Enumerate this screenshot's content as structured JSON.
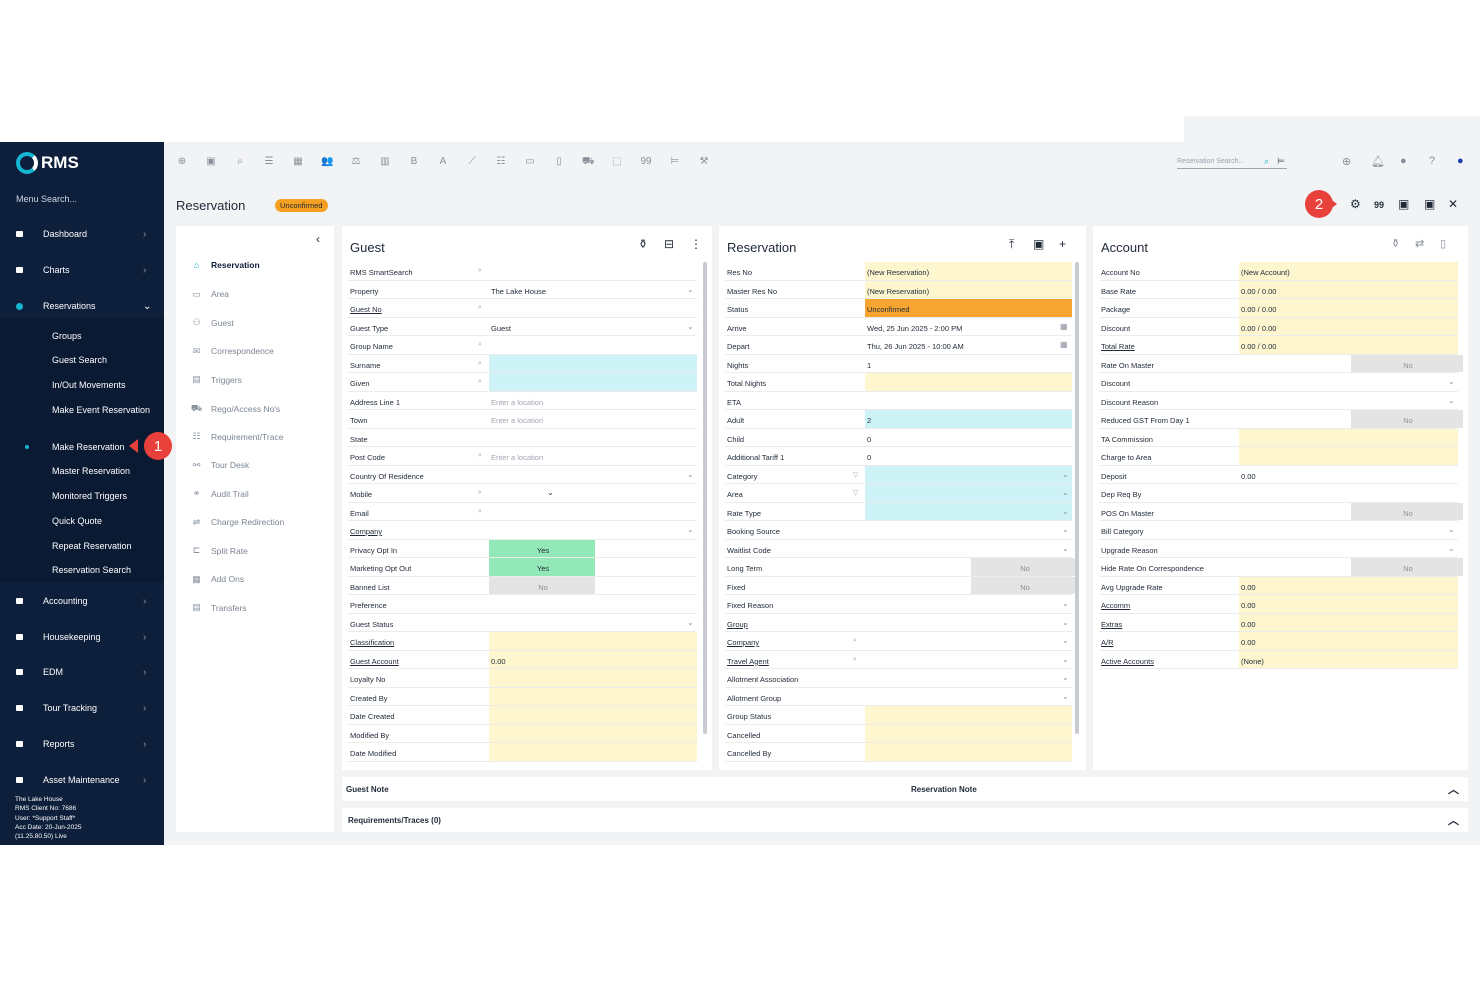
{
  "app": {
    "logo": "RMS"
  },
  "sidebar": {
    "search_placeholder": "Menu Search...",
    "items": [
      {
        "label": "Dashboard",
        "icon": "dashboard-icon"
      },
      {
        "label": "Charts",
        "icon": "charts-icon"
      },
      {
        "label": "Reservations",
        "icon": "reservations-icon"
      },
      {
        "label": "Accounting",
        "icon": "accounting-icon"
      },
      {
        "label": "Housekeeping",
        "icon": "housekeeping-icon"
      },
      {
        "label": "EDM",
        "icon": "edm-icon"
      },
      {
        "label": "Tour Tracking",
        "icon": "tour-tracking-icon"
      },
      {
        "label": "Reports",
        "icon": "reports-icon"
      },
      {
        "label": "Asset Maintenance",
        "icon": "asset-maintenance-icon"
      }
    ],
    "sub_items": [
      "Groups",
      "Guest Search",
      "In/Out Movements",
      "Make Event Reservation",
      "Make Reservation",
      "Master Reservation",
      "Monitored Triggers",
      "Quick Quote",
      "Repeat Reservation",
      "Reservation Search"
    ],
    "footer": [
      "The Lake House",
      "RMS Client No: 7686",
      "User: *Support Staff*",
      "Acc Date: 20-Jun-2025",
      "(11.25.80.50) Live"
    ]
  },
  "callouts": [
    "1",
    "2"
  ],
  "toolbar": {
    "icons": [
      "add-icon",
      "calendar-icon",
      "search-icon",
      "sliders-icon",
      "grid-icon",
      "users-icon",
      "money-icon",
      "map-icon",
      "bold-b-icon",
      "letter-a-icon",
      "line-chart-icon",
      "list-icon",
      "card-icon",
      "document-icon",
      "cart-icon",
      "tag-icon",
      "quote-icon",
      "bed-icon",
      "tools-icon"
    ],
    "icon_glyphs": [
      "⊕",
      "▣",
      "⌕",
      "☰",
      "▦",
      "👥",
      "⚖",
      "▥",
      "B",
      "A",
      "⟋",
      "☷",
      "▭",
      "▯",
      "⛟",
      "⬚",
      "99",
      "⊨",
      "⚒"
    ],
    "reservation_search_placeholder": "Reservation Search...",
    "right_icons": [
      "globe-icon",
      "bell-icon",
      "chat-icon",
      "help-icon",
      "user-icon"
    ]
  },
  "page": {
    "title": "Reservation",
    "status_badge": "Unconfirmed",
    "header_icons": [
      "settings-icon",
      "quote-icon",
      "save-icon",
      "save-close-icon",
      "close-icon"
    ],
    "quote_label": "99"
  },
  "left_nav": [
    "Reservation",
    "Area",
    "Guest",
    "Correspondence",
    "Triggers",
    "Rego/Access No's",
    "Requirement/Trace",
    "Tour Desk",
    "Audit Trail",
    "Charge Redirection",
    "Split Rate",
    "Add Ons",
    "Transfers"
  ],
  "guest": {
    "title": "Guest",
    "fields": [
      {
        "label": "RMS SmartSearch",
        "value": "",
        "mag": true
      },
      {
        "label": "Property",
        "value": "The Lake House",
        "chev": true
      },
      {
        "label": "Guest No",
        "value": "",
        "mag": true,
        "u": true
      },
      {
        "label": "Guest Type",
        "value": "Guest",
        "chev": true
      },
      {
        "label": "Group Name",
        "value": "",
        "mag": true
      },
      {
        "label": "Surname",
        "value": "",
        "mag": true,
        "bg": "c"
      },
      {
        "label": "Given",
        "value": "",
        "mag": true,
        "bg": "c"
      },
      {
        "label": "Address Line 1",
        "value": "Enter a location",
        "ph": true
      },
      {
        "label": "Town",
        "value": "Enter a location",
        "ph": true
      },
      {
        "label": "State",
        "value": ""
      },
      {
        "label": "Post Code",
        "value": "Enter a location",
        "ph": true,
        "mag": true
      },
      {
        "label": "Country Of Residence",
        "value": "",
        "chev": true
      },
      {
        "label": "Mobile",
        "value": "",
        "mag": true,
        "dd": true
      },
      {
        "label": "Email",
        "value": "",
        "mag": true
      },
      {
        "label": "Company",
        "value": "",
        "chev": true,
        "u": true
      },
      {
        "label": "Privacy Opt In",
        "value": "Yes",
        "toggle": "g"
      },
      {
        "label": "Marketing Opt Out",
        "value": "Yes",
        "toggle": "g"
      },
      {
        "label": "Banned List",
        "value": "No",
        "toggle": "gr"
      },
      {
        "label": "Preference",
        "value": ""
      },
      {
        "label": "Guest Status",
        "value": "",
        "chev": true
      },
      {
        "label": "Classification",
        "value": "",
        "bg": "y",
        "u": true
      },
      {
        "label": "Guest Account",
        "value": "0.00",
        "bg": "y",
        "u": true
      },
      {
        "label": "Loyalty No",
        "value": "",
        "bg": "y"
      },
      {
        "label": "Created By",
        "value": "",
        "bg": "y"
      },
      {
        "label": "Date Created",
        "value": "",
        "bg": "y"
      },
      {
        "label": "Modified By",
        "value": "",
        "bg": "y"
      },
      {
        "label": "Date Modified",
        "value": "",
        "bg": "y"
      }
    ]
  },
  "reservation": {
    "title": "Reservation",
    "fields": [
      {
        "label": "Res No",
        "value": "(New Reservation)",
        "bg": "y"
      },
      {
        "label": "Master Res No",
        "value": "(New Reservation)",
        "bg": "y"
      },
      {
        "label": "Status",
        "value": "Unconfirmed",
        "bg": "o"
      },
      {
        "label": "Arrive",
        "value": "Wed, 25 Jun 2025 - 2:00 PM",
        "cal": true
      },
      {
        "label": "Depart",
        "value": "Thu, 26 Jun 2025 - 10:00 AM",
        "cal": true
      },
      {
        "label": "Nights",
        "value": "1"
      },
      {
        "label": "Total Nights",
        "value": "",
        "bg": "y"
      },
      {
        "label": "ETA",
        "value": ""
      },
      {
        "label": "Adult",
        "value": "2",
        "bg": "c"
      },
      {
        "label": "Child",
        "value": "0"
      },
      {
        "label": "Additional Tariff 1",
        "value": "0"
      },
      {
        "label": "Category",
        "value": "",
        "bg": "c",
        "chev": true,
        "filter": true
      },
      {
        "label": "Area",
        "value": "",
        "bg": "c",
        "chev": true,
        "filter": true
      },
      {
        "label": "Rate Type",
        "value": "",
        "bg": "c",
        "chev": true
      },
      {
        "label": "Booking Source",
        "value": "",
        "chev": true
      },
      {
        "label": "Waitlist Code",
        "value": "",
        "chev": true
      },
      {
        "label": "Long Term",
        "value": "No",
        "toggle": "gr"
      },
      {
        "label": "Fixed",
        "value": "No",
        "toggle": "gr"
      },
      {
        "label": "Fixed Reason",
        "value": "",
        "chev": true
      },
      {
        "label": "Group",
        "value": "",
        "chev": true,
        "u": true
      },
      {
        "label": "Company",
        "value": "",
        "chev": true,
        "u": true,
        "mag": true
      },
      {
        "label": "Travel Agent",
        "value": "",
        "chev": true,
        "u": true,
        "mag": true
      },
      {
        "label": "Allotment Association",
        "value": "",
        "chev": true
      },
      {
        "label": "Allotment Group",
        "value": "",
        "chev": true
      },
      {
        "label": "Group Status",
        "value": "",
        "bg": "y"
      },
      {
        "label": "Cancelled",
        "value": "",
        "bg": "y"
      },
      {
        "label": "Cancelled By",
        "value": "",
        "bg": "y"
      }
    ]
  },
  "account": {
    "title": "Account",
    "fields": [
      {
        "label": "Account No",
        "value": "(New Account)",
        "bg": "y"
      },
      {
        "label": "Base Rate",
        "value": "0.00 / 0.00",
        "bg": "y"
      },
      {
        "label": "Package",
        "value": "0.00 / 0.00",
        "bg": "y"
      },
      {
        "label": "Discount",
        "value": "0.00 / 0.00",
        "bg": "y"
      },
      {
        "label": "Total Rate",
        "value": "0.00 / 0.00",
        "bg": "y",
        "u": true
      },
      {
        "label": "Rate On Master",
        "value": "No",
        "toggle": "gr"
      },
      {
        "label": "Discount",
        "value": "",
        "chev": true
      },
      {
        "label": "Discount Reason",
        "value": "",
        "chev": true
      },
      {
        "label": "Reduced GST From Day 1",
        "value": "No",
        "toggle": "gr"
      },
      {
        "label": "TA Commission",
        "value": "",
        "bg": "y"
      },
      {
        "label": "Charge to Area",
        "value": "",
        "bg": "y"
      },
      {
        "label": "Deposit",
        "value": "0.00"
      },
      {
        "label": "Dep Req By",
        "value": ""
      },
      {
        "label": "POS On Master",
        "value": "No",
        "toggle": "gr"
      },
      {
        "label": "Bill Category",
        "value": "",
        "chev": true
      },
      {
        "label": "Upgrade Reason",
        "value": "",
        "chev": true
      },
      {
        "label": "Hide Rate On Correspondence",
        "value": "No",
        "toggle": "gr"
      },
      {
        "label": "Avg Upgrade Rate",
        "value": "0.00",
        "bg": "y"
      },
      {
        "label": "Accomm",
        "value": "0.00",
        "bg": "y",
        "u": true
      },
      {
        "label": "Extras",
        "value": "0.00",
        "bg": "y",
        "u": true
      },
      {
        "label": "A/R",
        "value": "0.00",
        "bg": "y",
        "u": true
      },
      {
        "label": "Active Accounts",
        "value": "(None)",
        "bg": "y",
        "u": true
      }
    ]
  },
  "bottom": {
    "guest_note": "Guest Note",
    "reservation_note": "Reservation Note",
    "requirements": "Requirements/Traces (0)"
  }
}
